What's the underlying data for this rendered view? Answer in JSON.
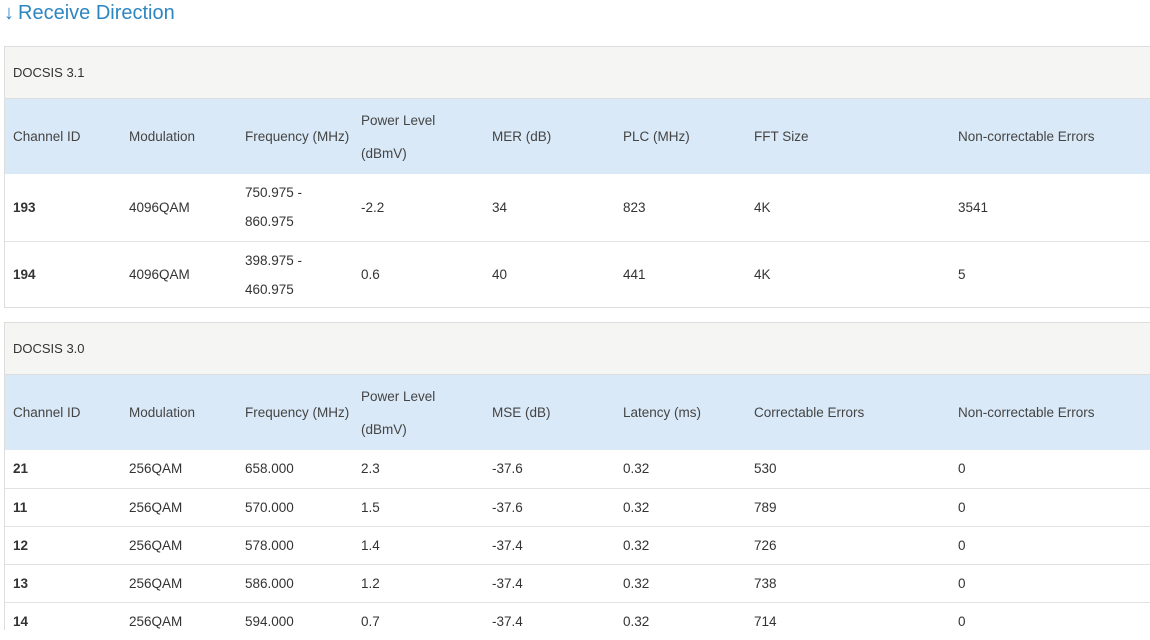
{
  "heading": {
    "arrow": "↓",
    "title": "Receive Direction"
  },
  "docsis31": {
    "title": "DOCSIS 3.1",
    "headers": [
      "Channel ID",
      "Modulation",
      "Frequency (MHz)",
      "Power Level (dBmV)",
      "MER (dB)",
      "PLC (MHz)",
      "FFT Size",
      "Non-correctable Errors"
    ],
    "rows": [
      [
        "193",
        "4096QAM",
        "750.975 - 860.975",
        "-2.2",
        "34",
        "823",
        "4K",
        "3541"
      ],
      [
        "194",
        "4096QAM",
        "398.975 - 460.975",
        "0.6",
        "40",
        "441",
        "4K",
        "5"
      ]
    ]
  },
  "docsis30": {
    "title": "DOCSIS 3.0",
    "headers": [
      "Channel ID",
      "Modulation",
      "Frequency (MHz)",
      "Power Level (dBmV)",
      "MSE (dB)",
      "Latency (ms)",
      "Correctable Errors",
      "Non-correctable Errors"
    ],
    "rows": [
      [
        "21",
        "256QAM",
        "658.000",
        "2.3",
        "-37.6",
        "0.32",
        "530",
        "0"
      ],
      [
        "11",
        "256QAM",
        "570.000",
        "1.5",
        "-37.6",
        "0.32",
        "789",
        "0"
      ],
      [
        "12",
        "256QAM",
        "578.000",
        "1.4",
        "-37.4",
        "0.32",
        "726",
        "0"
      ],
      [
        "13",
        "256QAM",
        "586.000",
        "1.2",
        "-37.4",
        "0.32",
        "738",
        "0"
      ],
      [
        "14",
        "256QAM",
        "594.000",
        "0.7",
        "-37.4",
        "0.32",
        "714",
        "0"
      ]
    ]
  }
}
